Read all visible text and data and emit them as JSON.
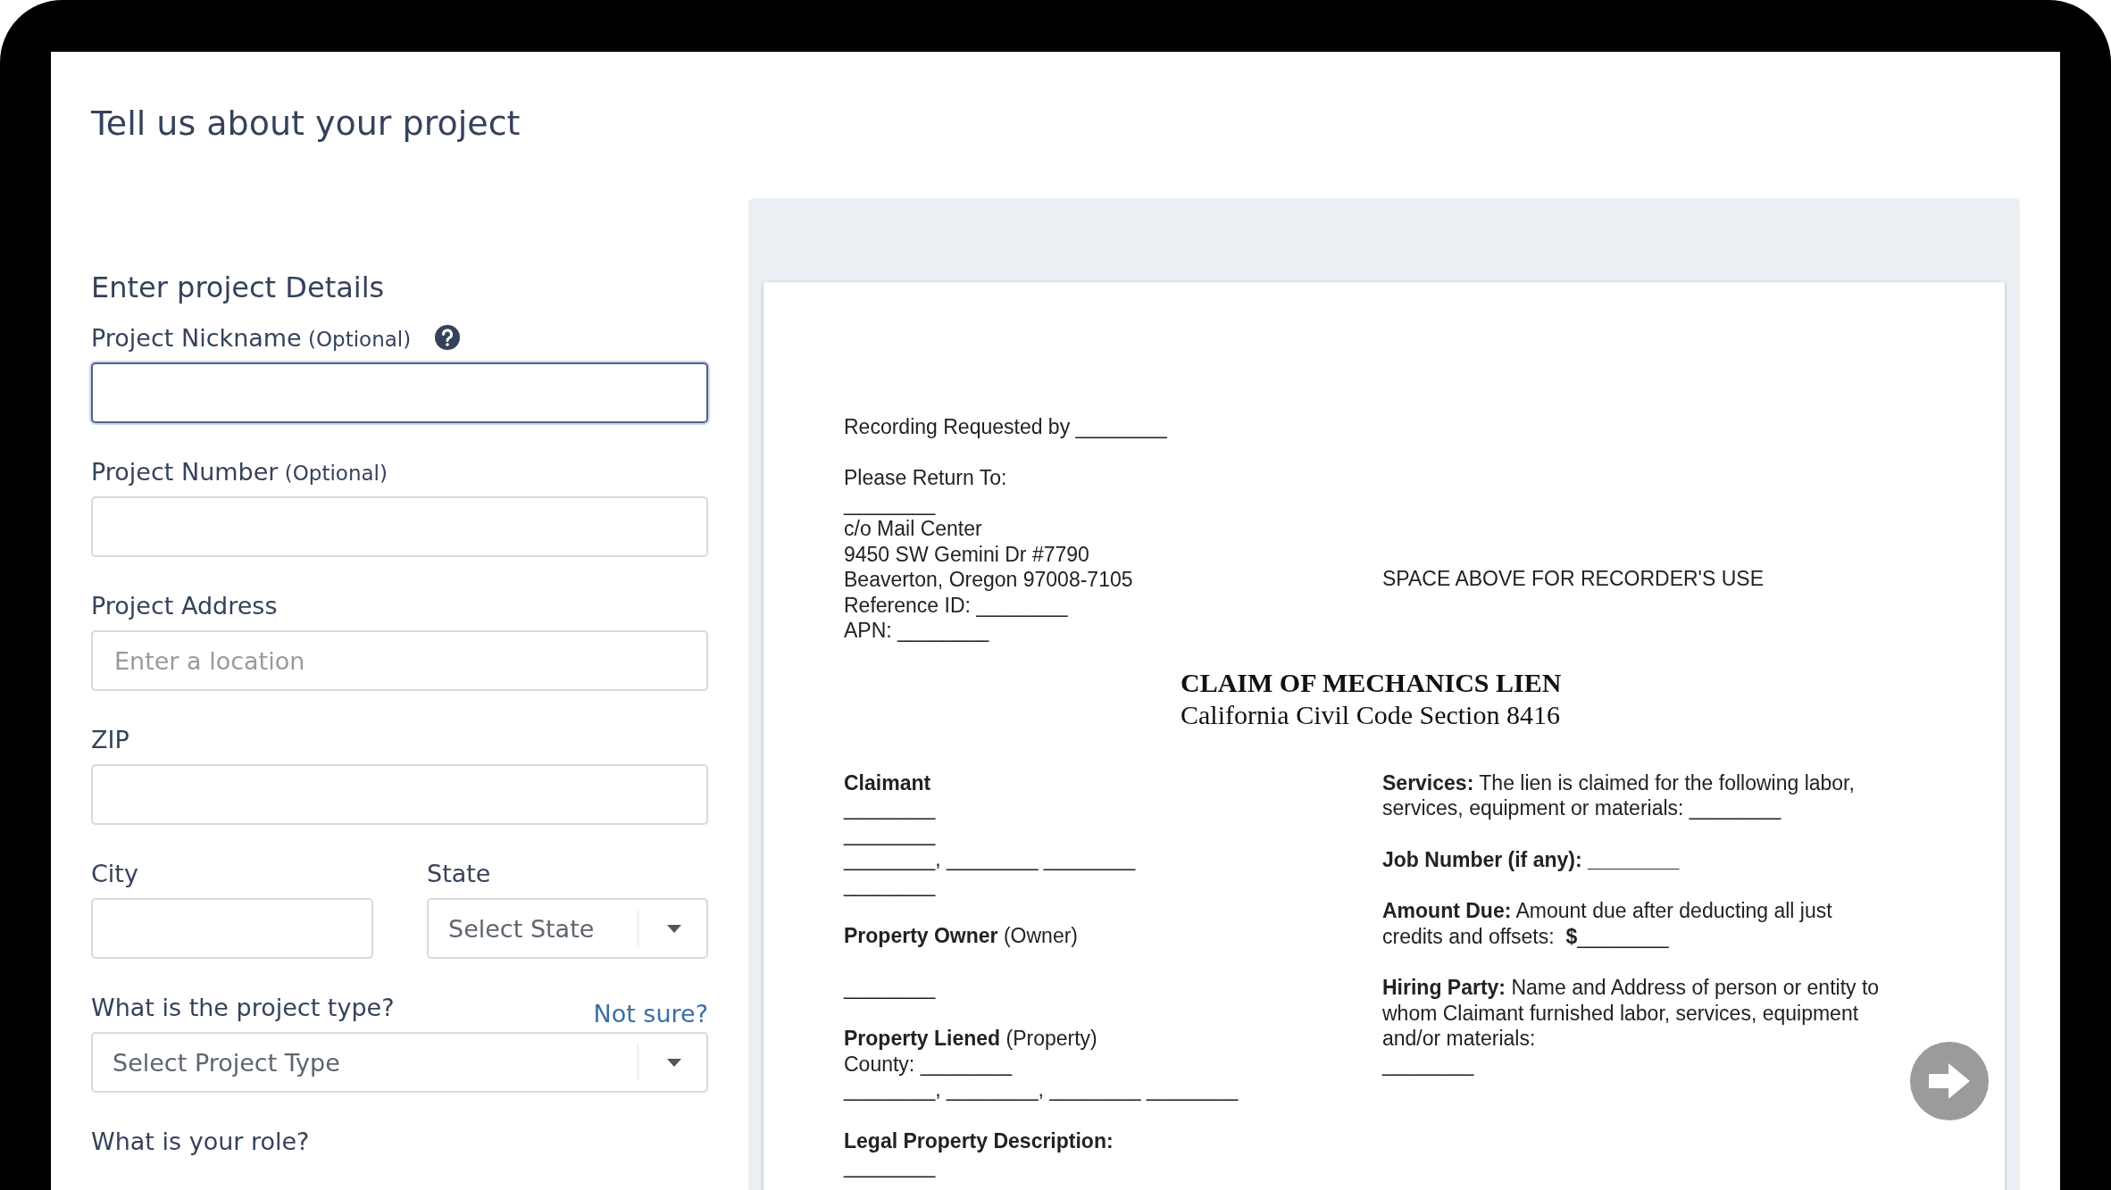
{
  "page": {
    "title": "Tell us about your project"
  },
  "form": {
    "heading": "Enter project Details",
    "rows": [
      {
        "fields": [
          {
            "kind": "input",
            "label": "Project Nickname",
            "note": "(Optional)",
            "help": true,
            "focused": true
          }
        ]
      },
      {
        "fields": [
          {
            "kind": "input",
            "label": "Project Number",
            "note": "(Optional)",
            "focused": false
          }
        ]
      },
      {
        "fields": [
          {
            "kind": "input",
            "label": "Project Address",
            "placeholder": "Enter a location",
            "focused": false
          }
        ]
      },
      {
        "fields": [
          {
            "kind": "input",
            "label": "ZIP",
            "focused": false
          }
        ]
      },
      {
        "fields": [
          {
            "kind": "input",
            "label": "City",
            "focused": false
          },
          {
            "kind": "select",
            "label": "State",
            "value": "Select State",
            "focused": false
          }
        ]
      },
      {
        "fields": [
          {
            "kind": "select",
            "label": "What is the project type?",
            "link": "Not sure?",
            "value": "Select Project Type",
            "focused": false
          }
        ]
      },
      {
        "fields": [
          {
            "kind": "label",
            "label": "What is your role?"
          }
        ]
      }
    ]
  },
  "document": {
    "header_groups": [
      [
        "Recording Requested by ________"
      ],
      [
        "Please Return To:",
        "________",
        "c/o Mail Center",
        "9450 SW Gemini Dr #7790",
        "Beaverton, Oregon 97008-7105",
        "Reference ID: ________",
        "APN: ________"
      ]
    ],
    "recorder_note": "SPACE ABOVE FOR RECORDER'S USE",
    "title": "CLAIM OF MECHANICS LIEN",
    "subtitle": "California Civil Code Section 8416",
    "left_blocks": [
      {
        "lines": [
          "Claimant",
          "________",
          "________",
          "________, ________ ________",
          "________"
        ],
        "bold_first": true
      },
      {
        "lines": [
          "**Property Owner** (Owner)"
        ],
        "bold_first": false
      },
      {
        "lines": [
          "________"
        ],
        "bold_first": false
      },
      {
        "lines": [
          "**Property Liened** (Property)",
          "County: ________",
          "________, ________, ________ ________"
        ],
        "bold_first": false
      },
      {
        "lines": [
          "Legal Property Description:",
          "________"
        ],
        "bold_first": true
      }
    ],
    "right_blocks": [
      {
        "lines": [
          "**Services:** The lien is claimed for the following labor,",
          "services, equipment or materials: ________"
        ],
        "bold_first": false
      },
      {
        "lines": [
          "Job Number (if any): ________"
        ],
        "bold_first": true
      },
      {
        "lines": [
          "**Amount Due:** Amount due after deducting all just",
          "credits and offsets:  **$**________"
        ],
        "bold_first": false
      },
      {
        "lines": [
          "**Hiring Party:** Name and Address of person or entity to",
          "whom Claimant furnished labor, services, equipment",
          "and/or materials:",
          "________"
        ],
        "bold_first": false
      }
    ]
  }
}
